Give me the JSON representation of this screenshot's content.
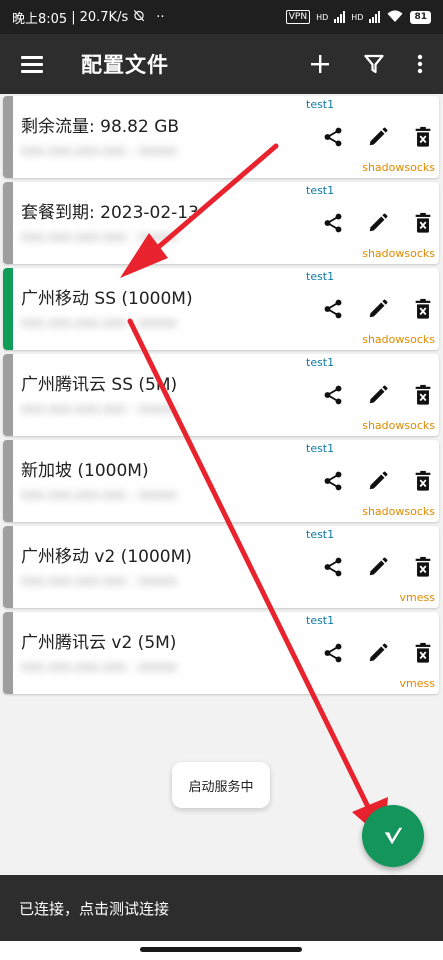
{
  "status_bar": {
    "time": "晚上8:05",
    "speed": "20.7K/s",
    "vpn_label": "VPN",
    "hd1": "HD",
    "hd2": "HD",
    "battery": "81"
  },
  "toolbar": {
    "title": "配置文件",
    "add_icon": "plus-icon",
    "filter_icon": "filter-icon",
    "more_icon": "more-vertical-icon"
  },
  "profiles": [
    {
      "name": "剩余流量: 98.82 GB",
      "address": "xxx.xxx.xxx.xxx : xxxxx",
      "subscription": "test1",
      "type": "shadowsocks",
      "selected": false
    },
    {
      "name": "套餐到期: 2023-02-13",
      "address": "xxx.xxx.xxx.xxx : xxxxx",
      "subscription": "test1",
      "type": "shadowsocks",
      "selected": false
    },
    {
      "name": "广州移动 SS (1000M)",
      "address": "xxx.xxx.xxx.xxx : xxxxx",
      "subscription": "test1",
      "type": "shadowsocks",
      "selected": true
    },
    {
      "name": "广州腾讯云 SS (5M)",
      "address": "xxx.xxx.xxx.xxx : xxxxx",
      "subscription": "test1",
      "type": "shadowsocks",
      "selected": false
    },
    {
      "name": "新加坡 (1000M)",
      "address": "xxx.xxx.xxx.xxx : xxxxx",
      "subscription": "test1",
      "type": "shadowsocks",
      "selected": false
    },
    {
      "name": "广州移动 v2 (1000M)",
      "address": "xxx.xxx.xxx.xxx : xxxxx",
      "subscription": "test1",
      "type": "vmess",
      "selected": false
    },
    {
      "name": "广州腾讯云 v2 (5M)",
      "address": "xxx.xxx.xxx.xxx : xxxxx",
      "subscription": "test1",
      "type": "vmess",
      "selected": false
    }
  ],
  "toast": "启动服务中",
  "fab_icon": "v-logo-icon",
  "bottom_status": "已连接，点击测试连接",
  "colors": {
    "accent": "#14955c",
    "selected_bar": "#0f9d58",
    "subscription_text": "#0e7aa8",
    "type_text": "#e08a00",
    "annotation_arrow": "#e8232e"
  }
}
